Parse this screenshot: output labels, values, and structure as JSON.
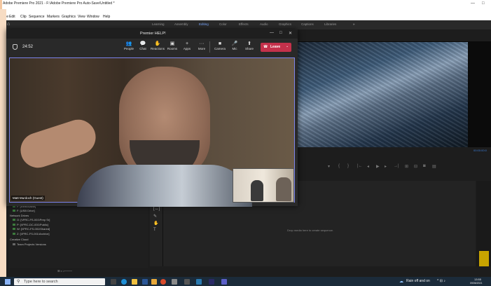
{
  "window": {
    "title": "Adobe Premiere Pro 2021 - F:\\Adobe Premiere Pro Auto-Save\\Untitled *",
    "minimize": "—",
    "maximize": "□"
  },
  "menu": [
    "File",
    "Edit",
    "Clip",
    "Sequence",
    "Markers",
    "Graphics",
    "View",
    "Window",
    "Help"
  ],
  "workspaces": {
    "items": [
      "Learning",
      "Assembly",
      "Editing",
      "Color",
      "Effects",
      "Audio",
      "Graphics",
      "Captions",
      "Libraries"
    ],
    "active": "Editing",
    "more": "»"
  },
  "teams": {
    "title": "Premier HELP!",
    "call_time": "24:52",
    "toolbar": [
      {
        "icon": "people-icon",
        "glyph": "👥",
        "label": "People"
      },
      {
        "icon": "chat-icon",
        "glyph": "💬",
        "label": "Chat"
      },
      {
        "icon": "reactions-icon",
        "glyph": "✋",
        "label": "Reactions"
      },
      {
        "icon": "rooms-icon",
        "glyph": "▣",
        "label": "Rooms"
      },
      {
        "icon": "apps-icon",
        "glyph": "+",
        "label": "Apps"
      },
      {
        "icon": "more-icon",
        "glyph": "···",
        "label": "More"
      },
      {
        "icon": "camera-icon",
        "glyph": "■",
        "label": "Camera"
      },
      {
        "icon": "mic-icon",
        "glyph": "🎤",
        "label": "Mic"
      },
      {
        "icon": "share-icon",
        "glyph": "⬆",
        "label": "Share"
      }
    ],
    "leave_label": "Leave",
    "participant_name": "Matt Murdoch (Guest)",
    "accent": "#7b83eb",
    "leave_color": "#c4314b"
  },
  "project_panel": {
    "bins": [
      "F: [Removable]",
      "F: [USB Drive]",
      "Network Drives",
      "O: [\\\\PRC-FS-001\\Prep Sr]",
      "P: [\\\\PRC-DC-001\\Public]",
      "W: [\\\\PRC-FS-001\\Shared]",
      "Z: [\\\\PRC-FS-001\\Archive]",
      "Creative Cloud",
      "Team Projects Versions"
    ]
  },
  "timeline": {
    "drop_hint": "Drop media here to create sequence."
  },
  "program_monitor": {
    "timecode": "00:00:00:0"
  },
  "taskbar": {
    "search_placeholder": "Type here to search",
    "weather": "Rain off and on",
    "time": "13:55",
    "date": "09/06/2021"
  }
}
